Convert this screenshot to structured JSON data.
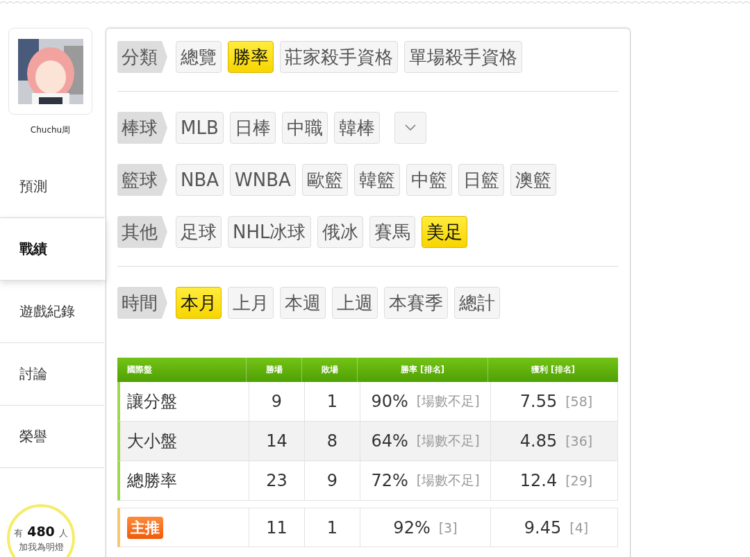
{
  "profile": {
    "name": "Chuchu周"
  },
  "nav": [
    {
      "label": "預測",
      "selected": false
    },
    {
      "label": "戰績",
      "selected": true
    },
    {
      "label": "遊戲紀錄",
      "selected": false
    },
    {
      "label": "討論",
      "selected": false
    },
    {
      "label": "榮譽",
      "selected": false
    }
  ],
  "fans": {
    "prefix": "有",
    "count": "480",
    "suffix": "人",
    "caption": "加我為明燈"
  },
  "filter_sections": [
    {
      "rows": [
        {
          "label": "分類",
          "has_more": false,
          "options": [
            {
              "label": "總覽",
              "selected": false
            },
            {
              "label": "勝率",
              "selected": true
            },
            {
              "label": "莊家殺手資格",
              "selected": false
            },
            {
              "label": "單場殺手資格",
              "selected": false
            }
          ]
        }
      ]
    },
    {
      "rows": [
        {
          "label": "棒球",
          "has_more": true,
          "options": [
            {
              "label": "MLB",
              "selected": false
            },
            {
              "label": "日棒",
              "selected": false
            },
            {
              "label": "中職",
              "selected": false
            },
            {
              "label": "韓棒",
              "selected": false
            }
          ]
        },
        {
          "label": "籃球",
          "has_more": false,
          "options": [
            {
              "label": "NBA",
              "selected": false
            },
            {
              "label": "WNBA",
              "selected": false
            },
            {
              "label": "歐籃",
              "selected": false
            },
            {
              "label": "韓籃",
              "selected": false
            },
            {
              "label": "中籃",
              "selected": false
            },
            {
              "label": "日籃",
              "selected": false
            },
            {
              "label": "澳籃",
              "selected": false
            }
          ]
        },
        {
          "label": "其他",
          "has_more": false,
          "options": [
            {
              "label": "足球",
              "selected": false
            },
            {
              "label": "NHL冰球",
              "selected": false
            },
            {
              "label": "俄冰",
              "selected": false
            },
            {
              "label": "賽馬",
              "selected": false
            },
            {
              "label": "美足",
              "selected": true
            }
          ]
        }
      ]
    },
    {
      "rows": [
        {
          "label": "時間",
          "has_more": false,
          "options": [
            {
              "label": "本月",
              "selected": true
            },
            {
              "label": "上月",
              "selected": false
            },
            {
              "label": "本週",
              "selected": false
            },
            {
              "label": "上週",
              "selected": false
            },
            {
              "label": "本賽季",
              "selected": false
            },
            {
              "label": "總計",
              "selected": false
            }
          ]
        }
      ]
    }
  ],
  "table": {
    "columns": [
      "國際盤",
      "勝場",
      "敗場",
      "勝率 [排名]",
      "獲利 [排名]"
    ],
    "rows": [
      {
        "label": "讓分盤",
        "wins": "9",
        "losses": "1",
        "rate": "90%",
        "rate_rank": "[場數不足]",
        "profit": "7.55",
        "profit_rank": "[58]"
      },
      {
        "label": "大小盤",
        "wins": "14",
        "losses": "8",
        "rate": "64%",
        "rate_rank": "[場數不足]",
        "profit": "4.85",
        "profit_rank": "[36]"
      },
      {
        "label": "總勝率",
        "wins": "23",
        "losses": "9",
        "rate": "72%",
        "rate_rank": "[場數不足]",
        "profit": "12.4",
        "profit_rank": "[29]"
      }
    ],
    "featured": {
      "badge": "主推",
      "wins": "11",
      "losses": "1",
      "rate": "92%",
      "rate_rank": "[3]",
      "profit": "9.45",
      "profit_rank": "[4]"
    }
  }
}
